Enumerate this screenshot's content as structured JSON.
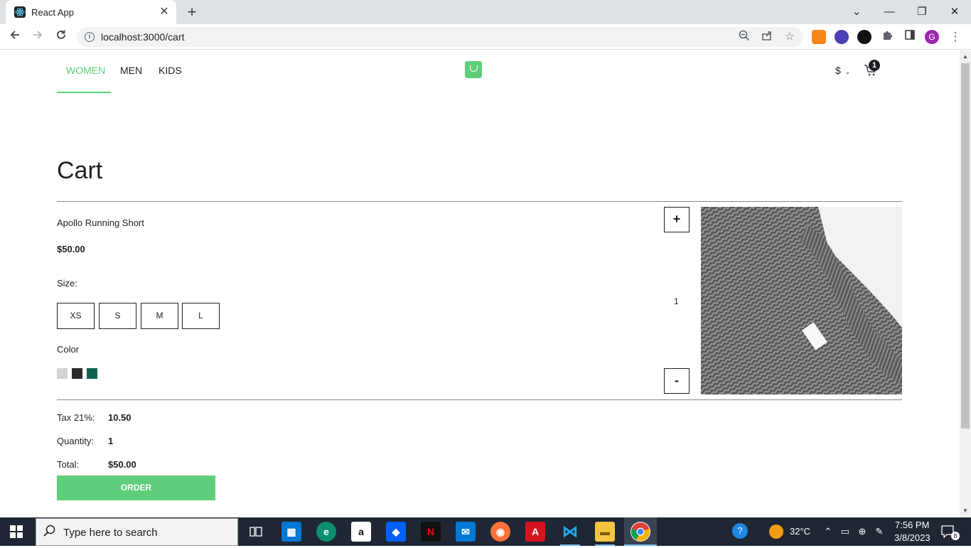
{
  "browser": {
    "tab_title": "React App",
    "tab_close": "✕",
    "new_tab": "+",
    "url": "localhost:3000/cart",
    "window": {
      "minimize": "—",
      "maximize": "❐",
      "close": "✕",
      "tab_search": "⌄"
    },
    "extensions": {
      "profile_initial": "G"
    }
  },
  "header": {
    "nav": [
      {
        "label": "WOMEN",
        "active": true
      },
      {
        "label": "MEN",
        "active": false
      },
      {
        "label": "KIDS",
        "active": false
      }
    ],
    "currency_symbol": "$",
    "currency_chevron": "⌄",
    "cart_count": "1",
    "accent_color": "#5ece7b"
  },
  "cart": {
    "title": "Cart",
    "items": [
      {
        "name": "Apollo Running Short",
        "price": "$50.00",
        "size_label": "Size:",
        "sizes": [
          "XS",
          "S",
          "M",
          "L"
        ],
        "color_label": "Color",
        "colors": [
          "#d3d2d5",
          "#2b2b2b",
          "#0f6450"
        ],
        "qty_plus": "+",
        "qty_minus": "-",
        "quantity": "1",
        "image": "gray-knit-sweater"
      }
    ],
    "summary": {
      "tax_label": "Tax 21%:",
      "tax_value": "10.50",
      "quantity_label": "Quantity:",
      "quantity_value": "1",
      "total_label": "Total:",
      "total_value": "$50.00"
    },
    "order_button": "ORDER"
  },
  "taskbar": {
    "search_placeholder": "Type here to search",
    "temperature": "32°C",
    "time": "7:56 PM",
    "date": "3/8/2023",
    "notification_count": "8"
  }
}
